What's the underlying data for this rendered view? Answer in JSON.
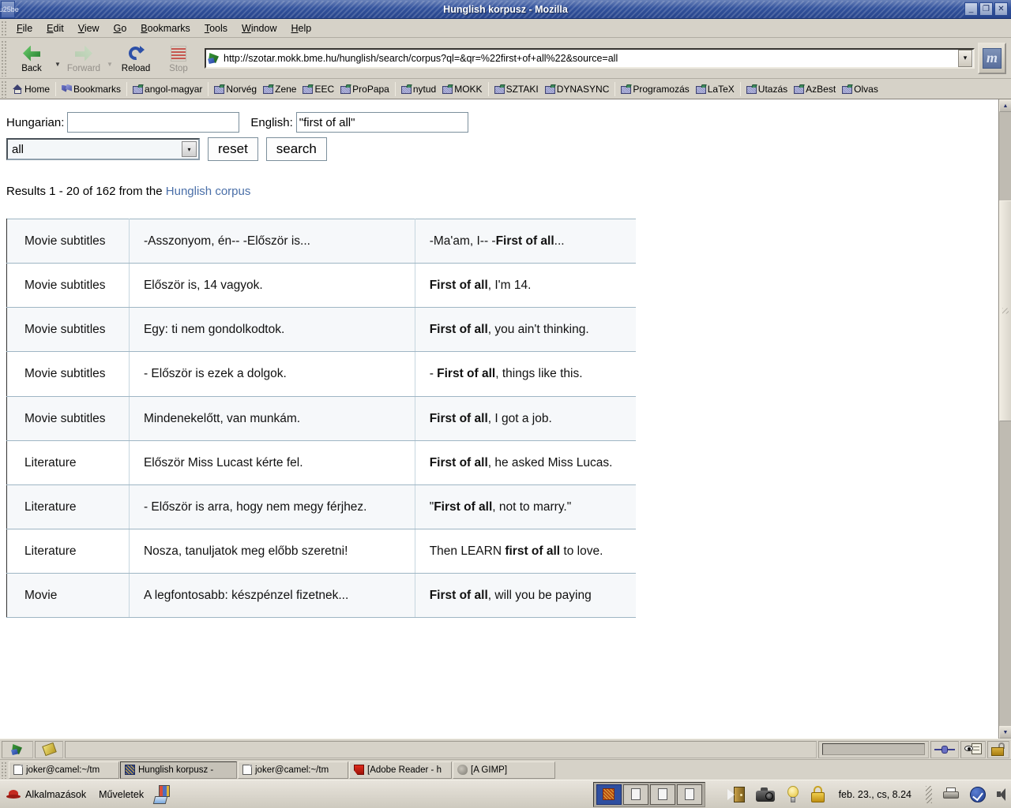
{
  "window": {
    "title": "Hunglish korpusz - Mozilla",
    "buttons": {
      "minimize": "_",
      "maximize": "❐",
      "close": "✕"
    }
  },
  "menubar": {
    "items": [
      {
        "label": "File",
        "access": "F"
      },
      {
        "label": "Edit",
        "access": "E"
      },
      {
        "label": "View",
        "access": "V"
      },
      {
        "label": "Go",
        "access": "G"
      },
      {
        "label": "Bookmarks",
        "access": "B"
      },
      {
        "label": "Tools",
        "access": "T"
      },
      {
        "label": "Window",
        "access": "W"
      },
      {
        "label": "Help",
        "access": "H"
      }
    ]
  },
  "toolbar": {
    "back_label": "Back",
    "forward_label": "Forward",
    "reload_label": "Reload",
    "stop_label": "Stop",
    "url": "http://szotar.mokk.bme.hu/hunglish/search/corpus?ql=&qr=%22first+of+all%22&source=all",
    "url_dropdown": "▾",
    "mozilla_logo": "m"
  },
  "bookmarks_bar": {
    "items": [
      {
        "label": "Home",
        "icon": "home-icon"
      },
      {
        "label": "Bookmarks",
        "icon": "bookmarks-icon"
      },
      {
        "label": "angol-magyar",
        "icon": "folder-icon"
      },
      {
        "label": "Norvég",
        "icon": "folder-icon"
      },
      {
        "label": "Zene",
        "icon": "folder-icon"
      },
      {
        "label": "EEC",
        "icon": "folder-icon"
      },
      {
        "label": "ProPapa",
        "icon": "folder-icon"
      },
      {
        "label": "nytud",
        "icon": "folder-icon"
      },
      {
        "label": "MOKK",
        "icon": "folder-icon"
      },
      {
        "label": "SZTAKI",
        "icon": "folder-icon"
      },
      {
        "label": "DYNASYNC",
        "icon": "folder-icon"
      },
      {
        "label": "Programozás",
        "icon": "folder-icon"
      },
      {
        "label": "LaTeX",
        "icon": "folder-icon"
      },
      {
        "label": "Utazás",
        "icon": "folder-icon"
      },
      {
        "label": "AzBest",
        "icon": "folder-icon"
      },
      {
        "label": "Olvas",
        "icon": "folder-icon"
      }
    ]
  },
  "page": {
    "form": {
      "hungarian_label": "Hungarian:",
      "hungarian_value": "",
      "hungarian_placeholder": "",
      "english_label": "English:",
      "english_value": "\"first of all\"",
      "english_placeholder": "",
      "source_selected": "all",
      "source_arrow": "▾",
      "reset_label": "reset",
      "search_label": "search"
    },
    "results_summary": {
      "prefix": "Results 1 - 20 of 162 from the ",
      "link": "Hunglish corpus"
    },
    "results": [
      {
        "source": "Movie subtitles",
        "hu": "-Asszonyom, én-- -Először is...",
        "en_pre": "-Ma'am, I-- -",
        "en_hit": "First of all",
        "en_post": "..."
      },
      {
        "source": "Movie subtitles",
        "hu": "Először is, 14 vagyok.",
        "en_pre": "",
        "en_hit": "First of all",
        "en_post": ", I'm 14."
      },
      {
        "source": "Movie subtitles",
        "hu": "Egy: ti nem gondolkodtok.",
        "en_pre": "",
        "en_hit": "First of all",
        "en_post": ", you ain't thinking."
      },
      {
        "source": "Movie subtitles",
        "hu": "- Először is ezek a dolgok.",
        "en_pre": "- ",
        "en_hit": "First of all",
        "en_post": ", things like this."
      },
      {
        "source": "Movie subtitles",
        "hu": "Mindenekelőtt, van munkám.",
        "en_pre": "",
        "en_hit": "First of all",
        "en_post": ", I got a job."
      },
      {
        "source": "Literature",
        "hu": "Először Miss Lucast kérte fel.",
        "en_pre": "",
        "en_hit": "First of all",
        "en_post": ", he asked Miss Lucas."
      },
      {
        "source": "Literature",
        "hu": "- Először is arra, hogy nem megy férjhez.",
        "en_pre": "\"",
        "en_hit": "First of all",
        "en_post": ", not to marry.\""
      },
      {
        "source": "Literature",
        "hu": "Nosza, tanuljatok meg előbb szeretni!",
        "en_pre": "Then LEARN ",
        "en_hit": "first of all",
        "en_post": " to love."
      },
      {
        "source": "Movie",
        "hu": "A legfontosabb: készpénzel fizetnek...",
        "en_pre": "",
        "en_hit": "First of all",
        "en_post": ", will you be paying"
      }
    ]
  },
  "scrollbar": {
    "up_arrow": "▲",
    "down_arrow": "▼"
  },
  "statusbar": {
    "message": "",
    "icons": [
      "connection-icon",
      "privacy-icon",
      "security-lock-icon"
    ]
  },
  "window_list": {
    "items": [
      {
        "label": "joker@camel:~/tm",
        "icon": "terminal-icon",
        "active": false
      },
      {
        "label": "Hunglish korpusz -",
        "icon": "mozilla-icon",
        "active": true
      },
      {
        "label": "joker@camel:~/tm",
        "icon": "terminal-icon",
        "active": false
      },
      {
        "label": "[Adobe Reader - h",
        "icon": "adobe-reader-icon",
        "active": false
      },
      {
        "label": "[A GIMP]",
        "icon": "gimp-icon",
        "active": false
      }
    ]
  },
  "gnome_panel": {
    "applications_label": "Alkalmazások",
    "actions_label": "Műveletek",
    "workspaces": [
      {
        "active": true
      },
      {
        "active": false
      },
      {
        "active": false
      },
      {
        "active": false
      }
    ],
    "clock": "feb. 23., cs,  8.24",
    "tray_icons": [
      "terminal-door-icon",
      "camera-icon",
      "bulb-icon",
      "lock-icon",
      "printer-icon",
      "updates-icon",
      "volume-icon"
    ]
  }
}
